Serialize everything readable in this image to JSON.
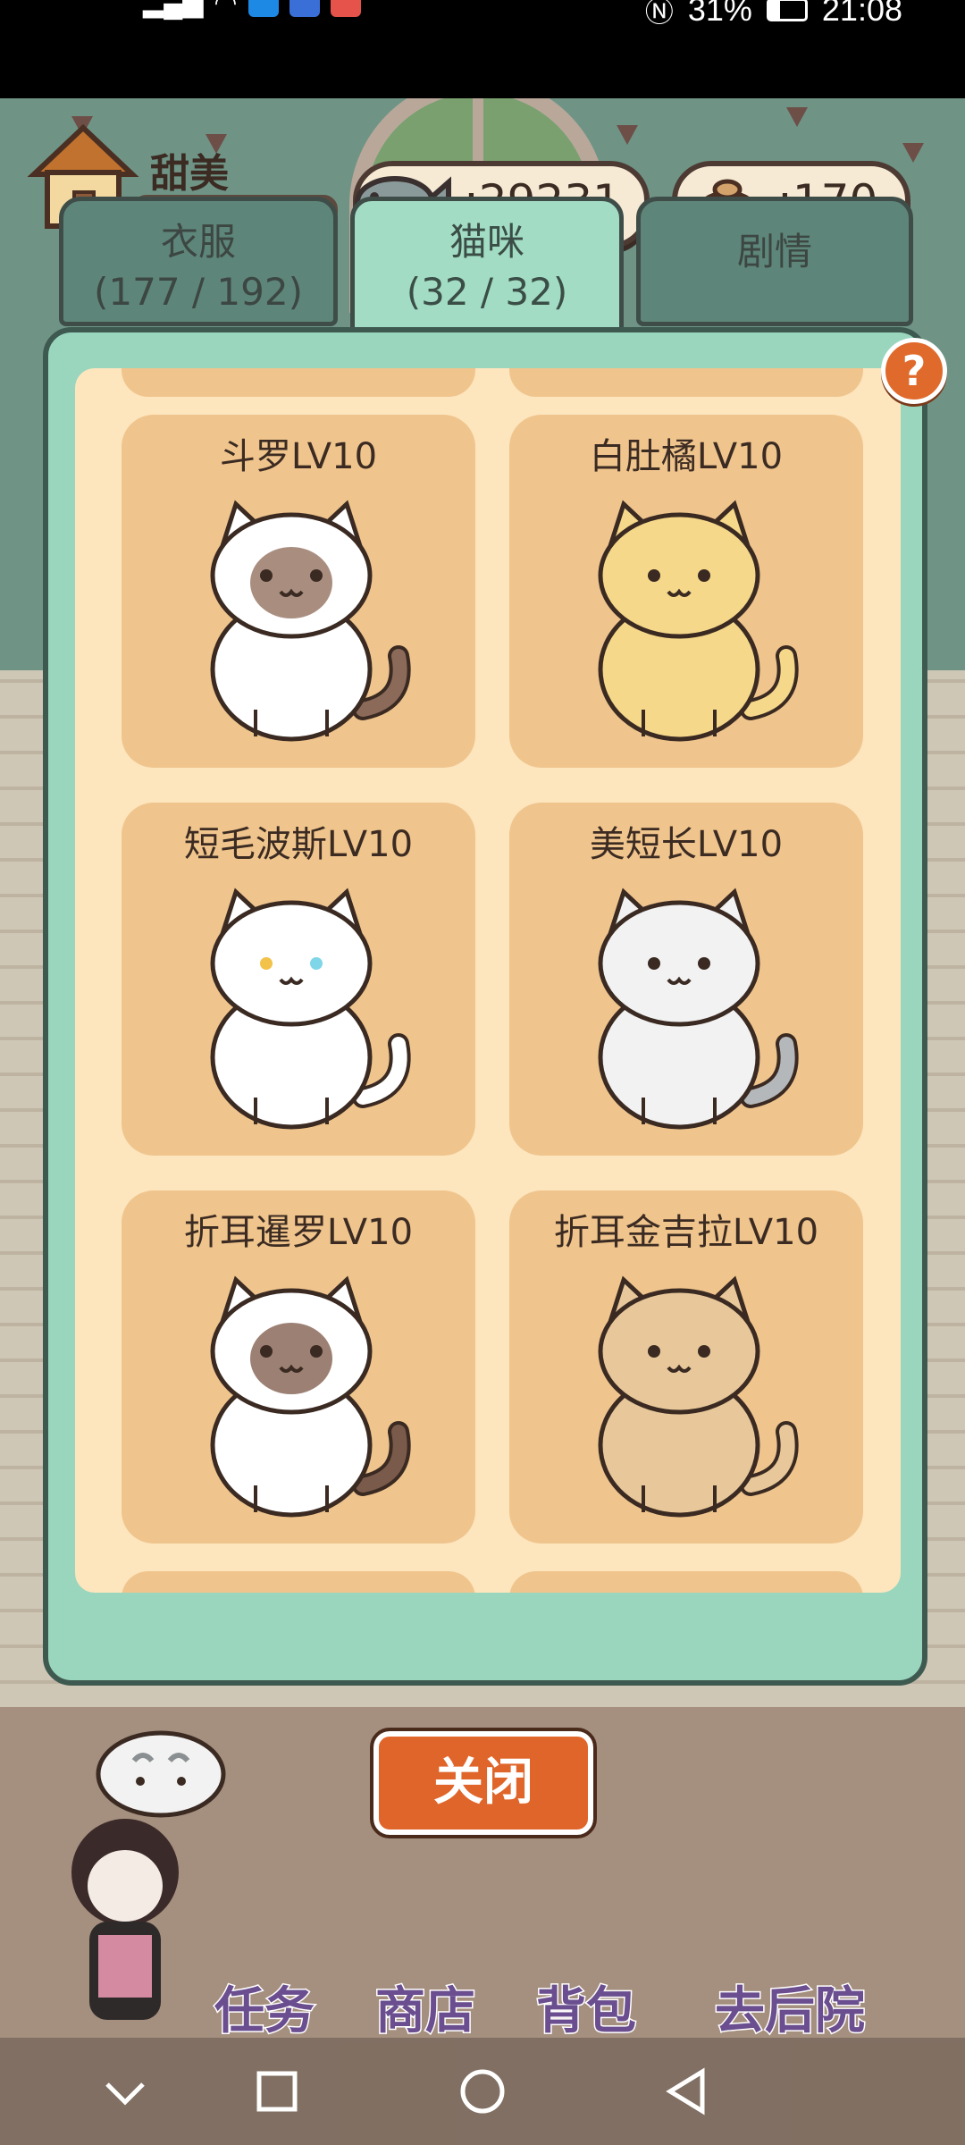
{
  "status_bar": {
    "time": "21:08",
    "battery": "31%",
    "signal_label": "all",
    "icons": [
      "signal-icon",
      "wifi-icon",
      "app-icon-blue",
      "music-icon",
      "app-icon-red",
      "nfc-icon",
      "battery-icon"
    ]
  },
  "player": {
    "name": "甜美",
    "fish": ":29231",
    "poop": ":170"
  },
  "tabs": [
    {
      "label": "衣服",
      "count": "(177 / 192)",
      "active": false
    },
    {
      "label": "猫咪",
      "count": "(32 / 32)",
      "active": true
    },
    {
      "label": "剧情",
      "count": "",
      "active": false
    }
  ],
  "help_label": "?",
  "cats": [
    {
      "name": "斗罗LV10",
      "fur": "#ffffff",
      "mask": "#9a7a6a",
      "tail": "#8b6a5a",
      "eyes": [
        "#3a2a22",
        "#3a2a22"
      ]
    },
    {
      "name": "白肚橘LV10",
      "fur": "#f6d88a",
      "mask": "",
      "tail": "#f6d88a",
      "eyes": [
        "#3a2a22",
        "#3a2a22"
      ]
    },
    {
      "name": "短毛波斯LV10",
      "fur": "#ffffff",
      "mask": "",
      "tail": "#ffffff",
      "eyes": [
        "#f2c24a",
        "#7fd6e8"
      ]
    },
    {
      "name": "美短长LV10",
      "fur": "#f2f2f2",
      "mask": "",
      "tail": "#b5b8bb",
      "eyes": [
        "#3a2a22",
        "#3a2a22"
      ]
    },
    {
      "name": "折耳暹罗LV10",
      "fur": "#ffffff",
      "mask": "#8b6a5a",
      "tail": "#7a5a4a",
      "eyes": [
        "#3a2a22",
        "#3a2a22"
      ]
    },
    {
      "name": "折耳金吉拉LV10",
      "fur": "#e8c89a",
      "mask": "",
      "tail": "#e8c89a",
      "eyes": [
        "#3a2a22",
        "#3a2a22"
      ]
    }
  ],
  "close_button": "关闭",
  "bottom_menu": [
    "任务",
    "商店",
    "背包",
    "去后院"
  ],
  "colors": {
    "accent_orange": "#e0652a",
    "panel_green": "#9ad6be",
    "card_tan": "#f0c58d"
  }
}
